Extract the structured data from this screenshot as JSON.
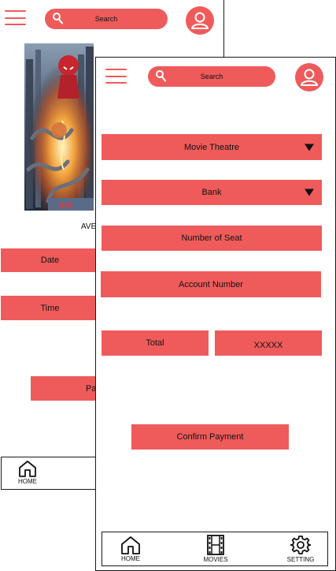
{
  "back_screen": {
    "search": {
      "label": "Search"
    },
    "movie_title_fragment": "AVE",
    "fields": {
      "date_label": "Date",
      "time_label": "Time",
      "pay_button_fragment": "Pa"
    },
    "bottom_nav": {
      "home_label": "HOME"
    }
  },
  "front_screen": {
    "search": {
      "label": "Search"
    },
    "form": {
      "movie_theatre_label": "Movie Theatre",
      "bank_label": "Bank",
      "number_of_seat_label": "Number of Seat",
      "account_number_label": "Account Number",
      "total_label": "Total",
      "total_value": "XXXXX"
    },
    "confirm_button_label": "Confirm Payment",
    "bottom_nav": {
      "home_label": "HOME",
      "movies_label": "MOVIES",
      "setting_label": "SETTING"
    }
  },
  "colors": {
    "accent": "#ef5b5b",
    "text": "#111111",
    "border": "#1a1a1a",
    "background": "#ffffff"
  },
  "icons": [
    "hamburger-menu-icon",
    "search-icon",
    "user-avatar-icon",
    "home-icon",
    "film-strip-icon",
    "gear-icon",
    "dropdown-caret-icon"
  ]
}
